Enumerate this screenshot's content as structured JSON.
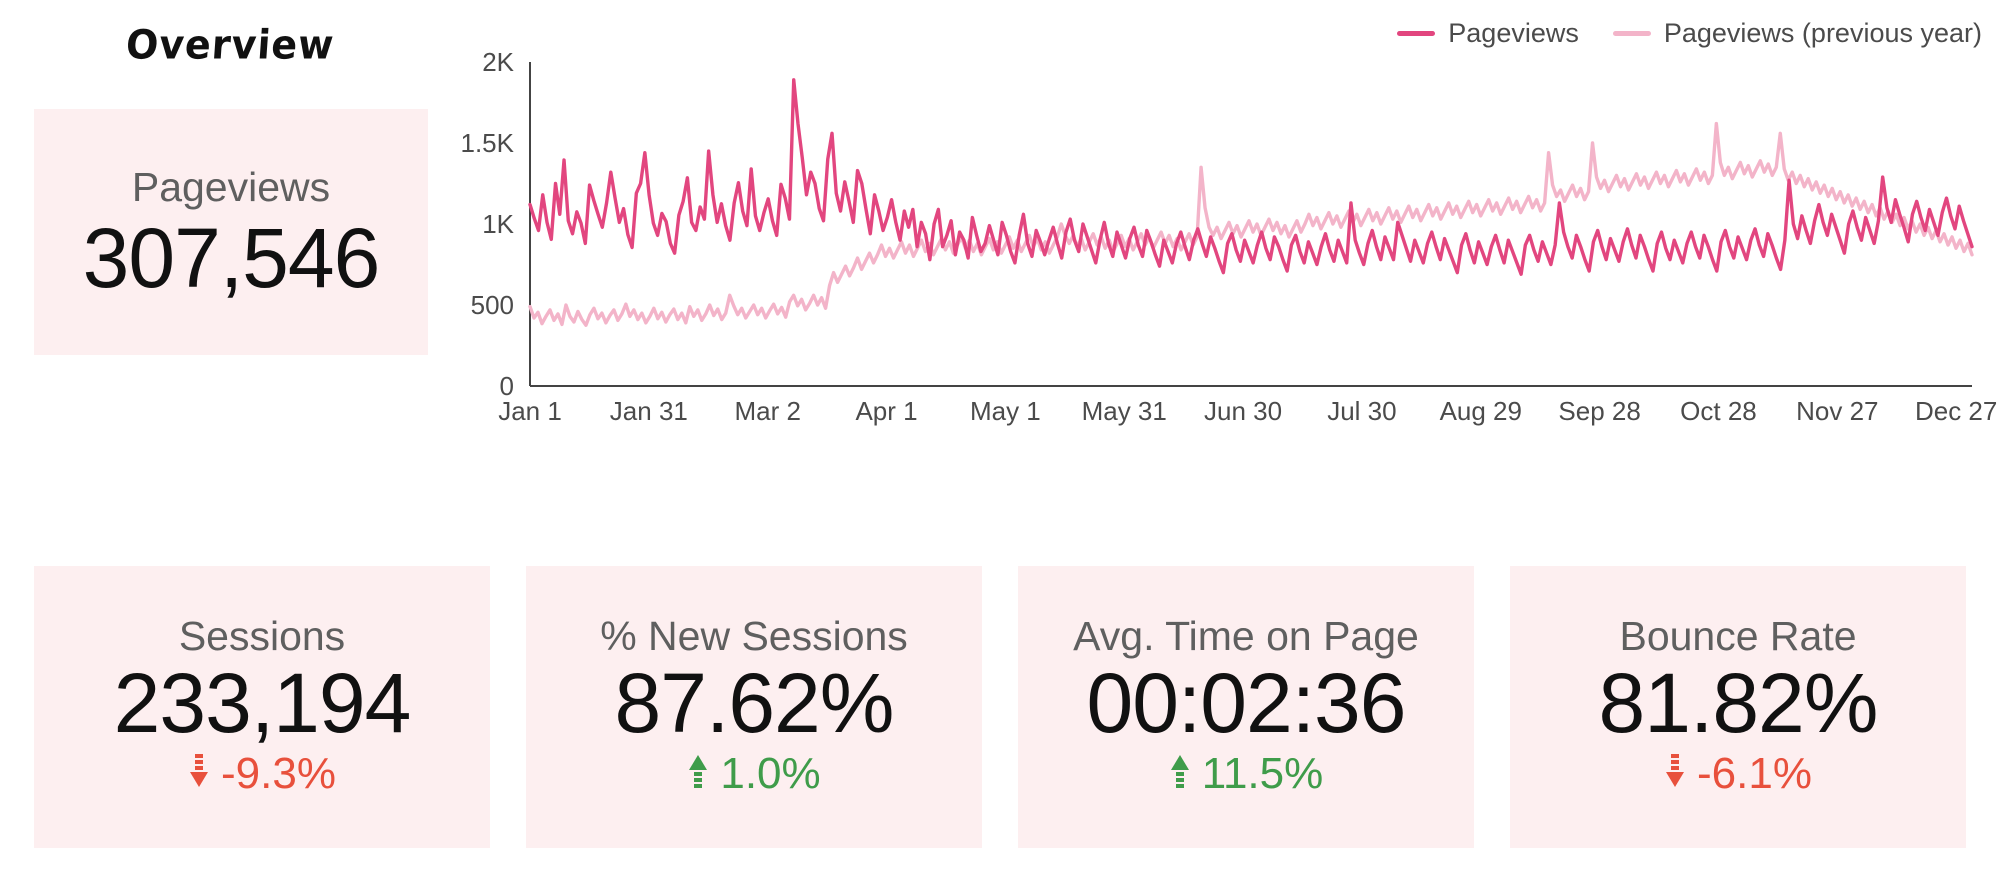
{
  "overview": {
    "title": "Overview",
    "hero": {
      "label": "Pageviews",
      "value": "307,546"
    }
  },
  "colors": {
    "current_series": "#e2467f",
    "previous_series": "#f3b4c9",
    "card_background": "#fdeff0",
    "positive": "#3f9c4a",
    "negative": "#e8503c",
    "axis": "#444444",
    "label_text": "#4b4b4b"
  },
  "legend": {
    "items": [
      {
        "label": "Pageviews",
        "color": "#e2467f"
      },
      {
        "label": "Pageviews (previous year)",
        "color": "#f3b4c9"
      }
    ]
  },
  "cards": [
    {
      "label": "Sessions",
      "value": "233,194",
      "delta": "-9.3%",
      "direction": "down",
      "arrow_icon": "arrow-down-icon"
    },
    {
      "label": "% New Sessions",
      "value": "87.62%",
      "delta": "1.0%",
      "direction": "up",
      "arrow_icon": "arrow-up-icon"
    },
    {
      "label": "Avg. Time on Page",
      "value": "00:02:36",
      "delta": "11.5%",
      "direction": "up",
      "arrow_icon": "arrow-up-icon"
    },
    {
      "label": "Bounce Rate",
      "value": "81.82%",
      "delta": "-6.1%",
      "direction": "down",
      "arrow_icon": "arrow-down-icon"
    }
  ],
  "chart_data": {
    "type": "line",
    "title": "",
    "xlabel": "",
    "ylabel": "",
    "grid": false,
    "legend_position": "top-right",
    "ylim": [
      0,
      2000
    ],
    "ytick_values": [
      0,
      500,
      1000,
      1500,
      2000
    ],
    "ytick_labels": [
      "0",
      "500",
      "1K",
      "1.5K",
      "2K"
    ],
    "xtick_labels": [
      "Jan 1",
      "Jan 31",
      "Mar 2",
      "Apr 1",
      "May 1",
      "May 31",
      "Jun 30",
      "Jul 30",
      "Aug 29",
      "Sep 28",
      "Oct 28",
      "Nov 27",
      "Dec 27"
    ],
    "xtick_indices": [
      0,
      30,
      60,
      90,
      120,
      150,
      180,
      210,
      240,
      270,
      300,
      330,
      360
    ],
    "x_count": 365,
    "series": [
      {
        "name": "Pageviews",
        "color": "#e2467f",
        "values": [
          1120,
          1035,
          960,
          1180,
          1010,
          905,
          1250,
          1060,
          1395,
          1020,
          940,
          1075,
          1005,
          880,
          1240,
          1145,
          1060,
          980,
          1130,
          1320,
          1160,
          1010,
          1095,
          935,
          855,
          1190,
          1250,
          1440,
          1180,
          1005,
          930,
          1065,
          1015,
          880,
          820,
          1055,
          1140,
          1285,
          1010,
          960,
          1105,
          1030,
          1450,
          1180,
          1010,
          1125,
          990,
          900,
          1130,
          1255,
          1080,
          990,
          1340,
          1050,
          960,
          1070,
          1155,
          1020,
          930,
          1245,
          1160,
          1030,
          1890,
          1620,
          1410,
          1180,
          1320,
          1250,
          1095,
          1020,
          1400,
          1560,
          1190,
          1080,
          1260,
          1140,
          1010,
          1330,
          1250,
          1090,
          940,
          1180,
          1080,
          960,
          1040,
          1150,
          1010,
          900,
          1080,
          980,
          1090,
          860,
          1010,
          940,
          780,
          1000,
          1090,
          860,
          930,
          1020,
          810,
          950,
          900,
          790,
          1040,
          930,
          830,
          880,
          990,
          900,
          810,
          1010,
          930,
          830,
          760,
          930,
          1060,
          880,
          800,
          960,
          890,
          810,
          900,
          980,
          880,
          790,
          950,
          1030,
          900,
          830,
          1000,
          920,
          840,
          760,
          900,
          1010,
          880,
          800,
          950,
          870,
          790,
          910,
          980,
          870,
          800,
          960,
          890,
          810,
          740,
          900,
          830,
          760,
          880,
          950,
          860,
          780,
          900,
          970,
          880,
          800,
          920,
          850,
          770,
          700,
          880,
          940,
          840,
          770,
          900,
          830,
          760,
          870,
          950,
          850,
          780,
          920,
          860,
          780,
          710,
          870,
          930,
          830,
          760,
          890,
          820,
          750,
          860,
          940,
          840,
          770,
          900,
          830,
          760,
          1130,
          900,
          820,
          750,
          880,
          960,
          860,
          780,
          920,
          850,
          780,
          1010,
          930,
          850,
          770,
          900,
          830,
          760,
          880,
          950,
          860,
          780,
          910,
          840,
          770,
          700,
          870,
          940,
          840,
          760,
          890,
          820,
          750,
          860,
          930,
          840,
          760,
          900,
          830,
          760,
          690,
          870,
          930,
          840,
          770,
          890,
          820,
          750,
          870,
          1130,
          950,
          860,
          790,
          930,
          860,
          780,
          710,
          890,
          960,
          860,
          780,
          910,
          840,
          770,
          890,
          970,
          870,
          790,
          930,
          860,
          780,
          710,
          880,
          950,
          850,
          780,
          900,
          830,
          760,
          880,
          950,
          860,
          790,
          930,
          860,
          780,
          710,
          890,
          960,
          860,
          790,
          920,
          850,
          780,
          900,
          970,
          870,
          800,
          940,
          870,
          790,
          720,
          900,
          1270,
          1000,
          910,
          1050,
          960,
          880,
          1020,
          1120,
          1010,
          930,
          1060,
          980,
          900,
          820,
          1000,
          1080,
          980,
          900,
          1040,
          960,
          880,
          1020,
          1290,
          1100,
          1010,
          1150,
          1060,
          980,
          890,
          1060,
          1140,
          1040,
          960,
          1090,
          1010,
          930,
          1070,
          1160,
          1050,
          970,
          1110,
          1020,
          940,
          860
        ]
      },
      {
        "name": "Pageviews (previous year)",
        "color": "#f3b4c9",
        "values": [
          490,
          420,
          455,
          385,
          430,
          470,
          405,
          445,
          380,
          500,
          430,
          395,
          460,
          410,
          375,
          440,
          480,
          415,
          450,
          390,
          435,
          470,
          405,
          445,
          505,
          430,
          470,
          410,
          450,
          390,
          430,
          480,
          415,
          455,
          395,
          440,
          475,
          410,
          450,
          390,
          490,
          430,
          470,
          405,
          445,
          500,
          435,
          475,
          410,
          450,
          560,
          495,
          440,
          480,
          420,
          460,
          500,
          440,
          480,
          420,
          465,
          505,
          445,
          485,
          425,
          520,
          560,
          495,
          535,
          470,
          510,
          560,
          500,
          545,
          480,
          620,
          700,
          640,
          690,
          740,
          680,
          730,
          790,
          720,
          770,
          820,
          760,
          810,
          870,
          800,
          850,
          790,
          840,
          890,
          820,
          870,
          800,
          850,
          900,
          830,
          880,
          810,
          860,
          910,
          840,
          890,
          820,
          870,
          920,
          850,
          900,
          830,
          880,
          810,
          860,
          910,
          840,
          890,
          820,
          870,
          920,
          850,
          900,
          830,
          880,
          930,
          860,
          910,
          840,
          890,
          820,
          870,
          920,
          1000,
          930,
          880,
          930,
          860,
          910,
          840,
          890,
          940,
          870,
          920,
          850,
          900,
          830,
          880,
          930,
          860,
          910,
          840,
          890,
          940,
          870,
          920,
          850,
          900,
          950,
          880,
          930,
          860,
          910,
          840,
          890,
          940,
          870,
          920,
          1350,
          1100,
          980,
          930,
          980,
          910,
          960,
          1010,
          940,
          990,
          920,
          970,
          1020,
          950,
          1000,
          930,
          980,
          1030,
          960,
          1010,
          940,
          990,
          920,
          970,
          1020,
          950,
          1000,
          1060,
          990,
          1040,
          970,
          1020,
          1070,
          1000,
          1050,
          980,
          1030,
          1080,
          1010,
          1060,
          990,
          1040,
          1090,
          1020,
          1070,
          1000,
          1050,
          1100,
          1030,
          1080,
          1010,
          1060,
          1110,
          1040,
          1090,
          1020,
          1070,
          1120,
          1050,
          1100,
          1030,
          1080,
          1130,
          1060,
          1110,
          1040,
          1090,
          1140,
          1070,
          1120,
          1050,
          1100,
          1150,
          1080,
          1130,
          1060,
          1110,
          1160,
          1090,
          1140,
          1070,
          1120,
          1170,
          1100,
          1150,
          1080,
          1130,
          1440,
          1240,
          1170,
          1210,
          1140,
          1190,
          1240,
          1170,
          1220,
          1150,
          1200,
          1500,
          1290,
          1220,
          1270,
          1200,
          1250,
          1300,
          1230,
          1280,
          1210,
          1260,
          1310,
          1240,
          1290,
          1220,
          1270,
          1320,
          1250,
          1300,
          1230,
          1280,
          1330,
          1260,
          1310,
          1240,
          1290,
          1340,
          1270,
          1320,
          1250,
          1300,
          1620,
          1380,
          1300,
          1350,
          1280,
          1330,
          1380,
          1310,
          1360,
          1290,
          1340,
          1390,
          1320,
          1370,
          1300,
          1350,
          1560,
          1340,
          1270,
          1320,
          1250,
          1300,
          1230,
          1280,
          1210,
          1260,
          1190,
          1240,
          1170,
          1220,
          1150,
          1200,
          1130,
          1180,
          1110,
          1160,
          1090,
          1140,
          1070,
          1120,
          1050,
          1100,
          1030,
          1080,
          1010,
          1060,
          990,
          1040,
          970,
          1020,
          950,
          1000,
          930,
          980,
          910,
          960,
          890,
          940,
          870,
          920,
          850,
          900,
          830,
          880,
          810
        ]
      }
    ]
  }
}
